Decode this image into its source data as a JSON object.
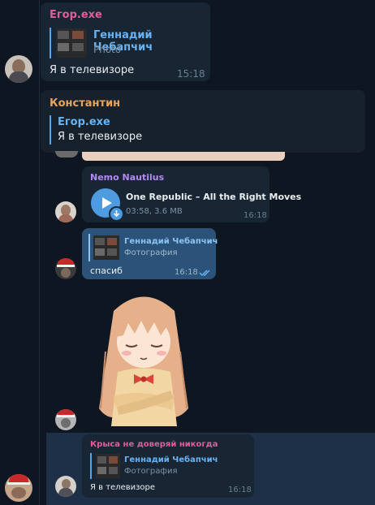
{
  "messages": {
    "m1": {
      "sender": "Егор.exe",
      "reply_name": "Геннадий Чебапчич",
      "reply_sub": "Photo",
      "text": "Я в телевизоре",
      "time": "15:18"
    },
    "m2": {
      "sender": "Константин",
      "reply_name": "Егор.exe",
      "reply_sub": "Я в телевизоре"
    },
    "m3": {
      "sender": "Nemo Nautilus",
      "track": "One Republic – All the Right Moves",
      "meta": "03:58, 3.6 MB",
      "time": "16:18"
    },
    "m4": {
      "reply_name": "Геннадий Чебапчич",
      "reply_sub": "Фотография",
      "text": "спасиб",
      "time": "16:18"
    },
    "m6": {
      "sender": "Крыса не доверяй никогда",
      "reply_name": "Геннадий Чебапчич",
      "reply_sub": "Фотография",
      "text": "Я в телевизоре",
      "time": "16:18"
    }
  },
  "colors": {
    "background": "#0e1621",
    "bubble": "#182533",
    "selected_row": "#1e3048",
    "accent": "#5fa5e6",
    "sender_pink": "#e35d9a",
    "sender_orange": "#e9a45c",
    "sender_purple": "#b18af2"
  },
  "icons": [
    "play-icon",
    "download-icon",
    "double-check-icon"
  ]
}
